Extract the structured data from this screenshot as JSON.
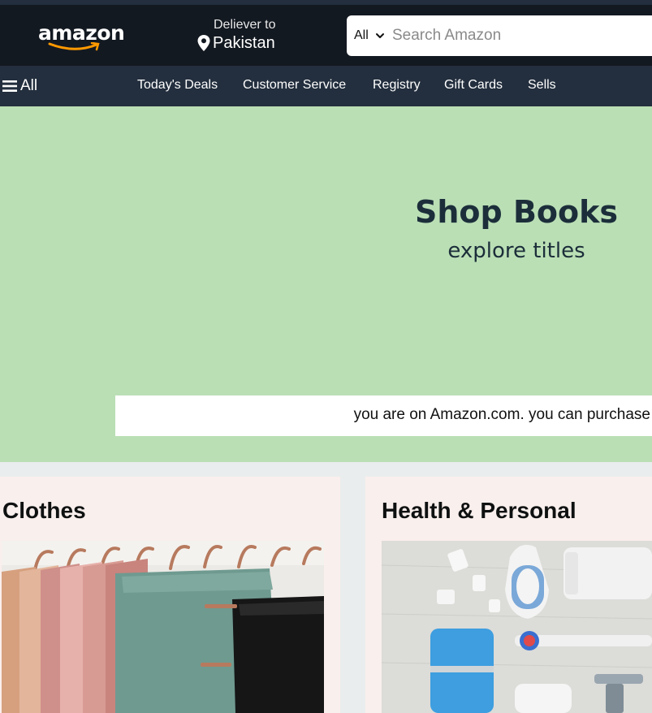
{
  "header": {
    "logo_text": "amazon",
    "deliver_label": "Deliever to",
    "deliver_country": "Pakistan",
    "search_category": "All",
    "search_placeholder": "Search Amazon",
    "icons": [
      "location-pin-icon",
      "chevron-down-icon"
    ]
  },
  "nav": {
    "all_label": "All",
    "links": [
      "Today's Deals",
      "Customer Service",
      "Registry",
      "Gift Cards",
      "Sells"
    ]
  },
  "hero": {
    "title": "Shop Books",
    "subtitle": "explore titles",
    "notice": "you are on Amazon.com. you can purchase"
  },
  "cards": [
    {
      "title": "Clothes"
    },
    {
      "title": "Health & Personal"
    }
  ],
  "colors": {
    "header_bg": "#131921",
    "nav_bg": "#232f3e",
    "hero_bg": "#badfb5",
    "card_bg": "#f9efed",
    "logo_smile": "#ff9900"
  }
}
